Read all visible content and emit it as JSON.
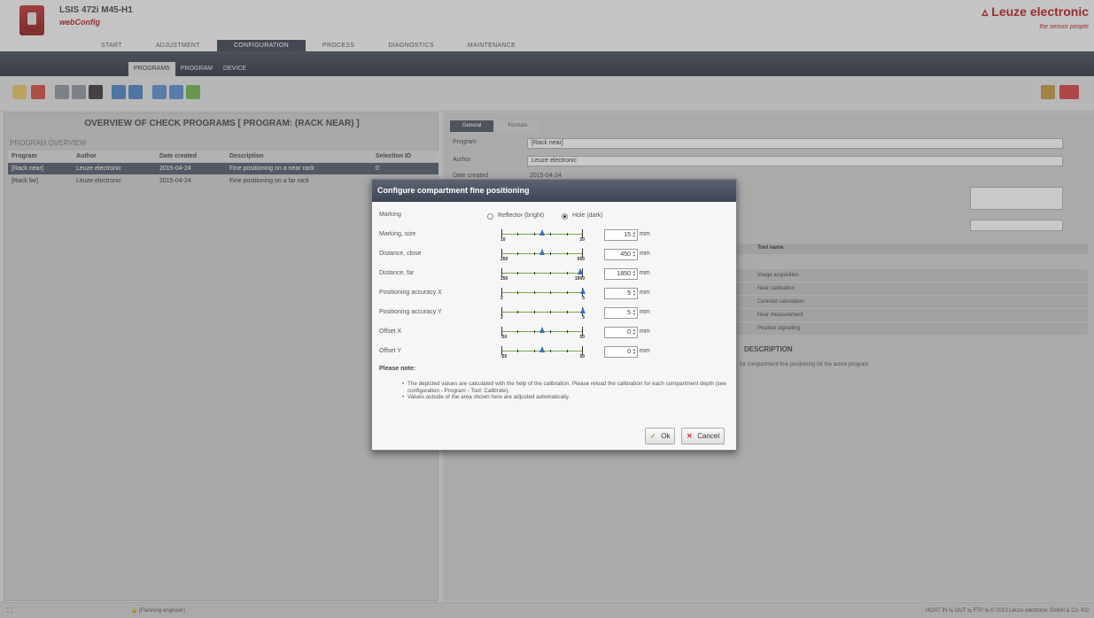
{
  "app": {
    "device": "LSIS 472i M45-H1",
    "name": "webConfig",
    "brand": "Leuze electronic",
    "tagline": "the sensor people"
  },
  "main_tabs": [
    "START",
    "ADJUSTMENT",
    "CONFIGURATION",
    "PROCESS",
    "DIAGNOSTICS",
    "MAINTENANCE"
  ],
  "sub_tabs": [
    "PROGRAMS",
    "PROGRAM",
    "DEVICE"
  ],
  "left": {
    "title": "OVERVIEW OF CHECK PROGRAMS   [ PROGRAM: (RACK NEAR) ]",
    "section": "PROGRAM OVERVIEW",
    "columns": [
      "Program",
      "Author",
      "Date created",
      "Description",
      "Selection ID"
    ],
    "rows": [
      {
        "program": "[Rack near]",
        "author": "Leuze electronic",
        "date": "2015-04-24",
        "description": "Fine positioning on a near rack",
        "selection_id": "0"
      },
      {
        "program": "[Rack far]",
        "author": "Leuze electronic",
        "date": "2015-04-24",
        "description": "Fine positioning on a far rack",
        "selection_id": ""
      }
    ]
  },
  "right": {
    "tabs": [
      "General",
      "Formats"
    ],
    "fields": [
      {
        "label": "Program",
        "value": "[Rack near]"
      },
      {
        "label": "Author",
        "value": "Leuze electronic"
      },
      {
        "label": "Date created",
        "value": "2015-04-24"
      }
    ],
    "tool_header": "Tool name",
    "tools": [
      "Image acquisition",
      "Near calibration",
      "Centroid calculation",
      "Near measurement",
      "Position signalling"
    ],
    "description_title": "DESCRIPTION",
    "description_text": "for compartment fine positioning for the active program"
  },
  "modal": {
    "title": "Configure compartment fine positioning",
    "marking_label": "Marking",
    "marking_options": [
      "Reflector (bright)",
      "Hole (dark)"
    ],
    "marking_selected": "Hole (dark)",
    "rows": [
      {
        "label": "Marking, size",
        "min": "10",
        "max": "20",
        "value": "15",
        "unit": "mm",
        "pos": 0.5
      },
      {
        "label": "Distance, close",
        "min": "250",
        "max": "650",
        "value": "450",
        "unit": "mm",
        "pos": 0.5
      },
      {
        "label": "Distance, far",
        "min": "250",
        "max": "1900",
        "value": "1850",
        "unit": "mm",
        "pos": 0.97
      },
      {
        "label": "Positioning accuracy X",
        "min": "2",
        "max": "5",
        "value": "5",
        "unit": "mm",
        "pos": 1.0
      },
      {
        "label": "Positioning accuracy Y",
        "min": "2",
        "max": "5",
        "value": "5",
        "unit": "mm",
        "pos": 1.0
      },
      {
        "label": "Offset X",
        "min": "-50",
        "max": "50",
        "value": "0",
        "unit": "mm",
        "pos": 0.5
      },
      {
        "label": "Offset Y",
        "min": "-50",
        "max": "50",
        "value": "0",
        "unit": "mm",
        "pos": 0.5
      }
    ],
    "note_title": "Please note:",
    "notes": [
      "The depicted values are calculated with the help of the calibration. Please reload the calibration for each compartment depth (see configuration - Program - Tool: Calibrate).",
      "Values outside of the area shown here are adjusted automatically."
    ],
    "ok_label": "Ok",
    "cancel_label": "Cancel"
  },
  "status": {
    "user": "[Planning engineer]",
    "right": "HOST IN ⇆  OUT ⇆  FTP ⇆    © 2013 Leuze electronic GmbH & Co. KG"
  }
}
